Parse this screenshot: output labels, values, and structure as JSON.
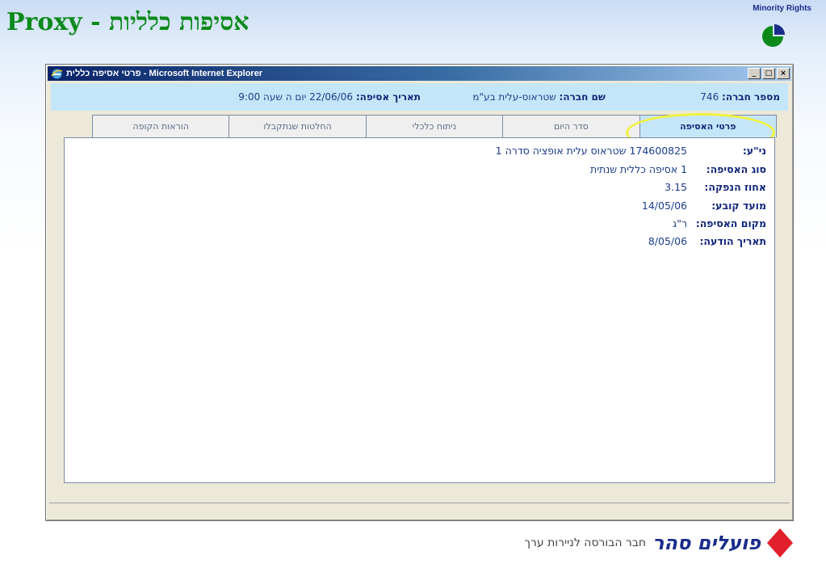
{
  "slide": {
    "title": "אסיפות כלליות - Proxy",
    "corner_label": "Minority Rights",
    "corner_icon": "pie-chart-icon"
  },
  "window": {
    "title": "פרטי אסיפה כללית - Microsoft Internet Explorer",
    "minimize_glyph": "_",
    "maximize_glyph": "□",
    "close_glyph": "×"
  },
  "info_bar": {
    "company_id_label": "מספר חברה:",
    "company_id_value": "746",
    "company_name_label": "שם חברה:",
    "company_name_value": "שטראוס-עלית בע\"מ",
    "meeting_date_label": "תאריך אסיפה:",
    "meeting_date_value": "22/06/06 יום ה שעה 9:00"
  },
  "tabs": [
    {
      "label": "פרטי האסיפה",
      "active": true
    },
    {
      "label": "סדר היום",
      "active": false
    },
    {
      "label": "ניתוח כלכלי",
      "active": false
    },
    {
      "label": "החלטות שנתקבלו",
      "active": false
    },
    {
      "label": "הוראות הקופה",
      "active": false
    }
  ],
  "details": {
    "security_label": "ני\"ע:",
    "security_value": "174600825 שטראוס עלית אופציה סדרה 1",
    "meeting_type_label": "סוג האסיפה:",
    "meeting_type_value": "1 אסיפה כללית שנתית",
    "holding_pct_label": "אחוז הנפקה:",
    "holding_pct_value": "3.15",
    "record_date_label": "מועד קובע:",
    "record_date_value": "14/05/06",
    "location_label": "מקום האסיפה:",
    "location_value": "ר\"ג",
    "notice_date_label": "תאריך הודעה:",
    "notice_date_value": "8/05/06"
  },
  "footer": {
    "brand_name": "פועלים סהר",
    "tagline": "חבר הבורסה לניירות ערך",
    "logo_color": "#e0202a"
  },
  "colors": {
    "title_green": "#0b8a1a",
    "label_navy": "#13267a",
    "value_blue": "#1a3d8c",
    "header_light_blue": "#c5e6f8",
    "highlight_yellow": "#f2f23a"
  }
}
